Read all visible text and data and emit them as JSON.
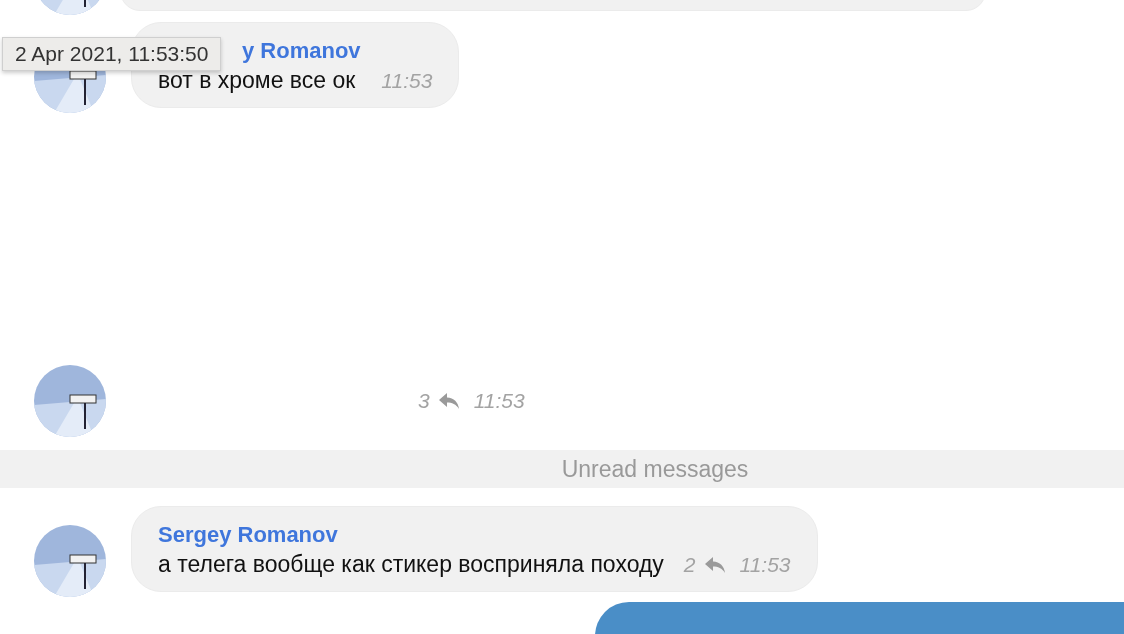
{
  "messages": [
    {
      "kind": "cut"
    },
    {
      "kind": "text",
      "author": "y Romanov",
      "text": "вот в хроме все ок",
      "time": "11:53"
    },
    {
      "kind": "sticker",
      "replies": "3",
      "time": "11:53"
    },
    {
      "kind": "divider",
      "label": "Unread messages"
    },
    {
      "kind": "text",
      "author": "Sergey Romanov",
      "text": "а телега вообще как стикер восприняла походу",
      "replies": "2",
      "time": "11:53"
    },
    {
      "kind": "outgoing"
    }
  ],
  "tooltip": "2 Apr 2021, 11:53:50"
}
